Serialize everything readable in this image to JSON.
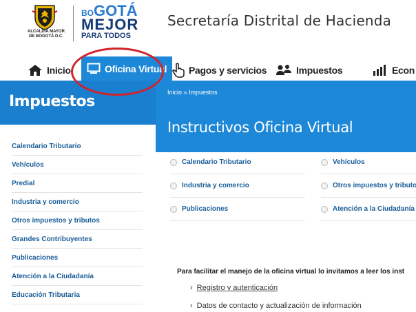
{
  "header": {
    "alcaldia_line1": "ALCALDÍA MAYOR",
    "alcaldia_line2": "DE BOGOTÁ D.C.",
    "brand_line1_small": "BO",
    "brand_line1_big": "GOTÁ",
    "brand_line2": "MEJOR",
    "brand_line3": "PARA TODOS",
    "site_title": "Secretaría Distrital de Hacienda"
  },
  "nav": {
    "items": [
      {
        "label": "Inicio",
        "icon": "home-icon"
      },
      {
        "label": "Oficina Virtual",
        "icon": "monitor-icon",
        "active": true
      },
      {
        "label": "Pagos y servicios",
        "icon": "hand-pointer-icon"
      },
      {
        "label": "Impuestos",
        "icon": "people-icon"
      },
      {
        "label": "Econ",
        "icon": "bar-chart-icon"
      }
    ]
  },
  "sidebar": {
    "title": "Impuestos",
    "items": [
      "Calendario Tributario",
      "Vehículos",
      "Predial",
      "Industria y comercio",
      "Otros impuestos y tributos",
      "Grandes Contribuyentes",
      "Publicaciones",
      "Atención a la Ciudadanía",
      "Educación Tributaria"
    ]
  },
  "main": {
    "breadcrumb": "Inicio » Impuestos",
    "title": "Instructivos Oficina Virtual",
    "options_col1": [
      "Calendario Tributario",
      "Industria y comercio",
      "Publicaciones"
    ],
    "options_col2": [
      "Vehículos",
      "Otros impuestos y tributos",
      "Atención a la Ciudadanía"
    ],
    "intro": "Para facilitar el manejo de la oficina virtual lo invitamos a leer los inst",
    "links": [
      "Registro y autenticación",
      "Datos de contacto y actualización de información"
    ]
  },
  "colors": {
    "primary_blue": "#1e88d8",
    "link_blue": "#1a5d98",
    "annotation_red": "#d4222a"
  }
}
